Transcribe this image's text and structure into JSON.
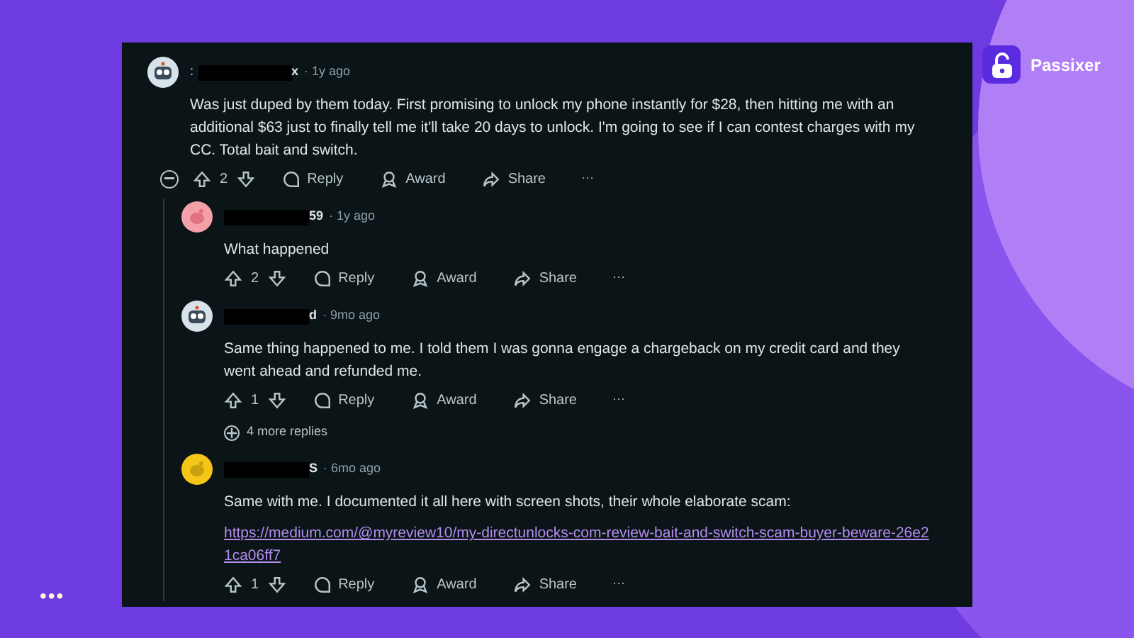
{
  "brand": {
    "name": "Passixer"
  },
  "more_button": {
    "label": "•••"
  },
  "comments": [
    {
      "author_suffix": ":",
      "author_end": "x",
      "time": "· 1y ago",
      "avatar": {
        "kind": "robot"
      },
      "collapse": true,
      "body": [
        "Was just duped by them today. First promising to unlock my phone instantly for $28, then hitting me with an additional $63 just to finally tell me it'll take 20 days to unlock. I'm going to see if I can contest charges with my CC. Total bait and switch."
      ],
      "votes": "2",
      "actions": [
        "Reply",
        "Award",
        "Share"
      ],
      "menu": "···",
      "children": [
        {
          "author_end": "59",
          "time": "· 1y ago",
          "avatar": {
            "kind": "pink"
          },
          "body": [
            "What happened"
          ],
          "votes": "2",
          "actions": [
            "Reply",
            "Award",
            "Share"
          ],
          "menu": "···"
        },
        {
          "author_end": "d",
          "time": "· 9mo ago",
          "avatar": {
            "kind": "robot"
          },
          "body": [
            "Same thing happened to me. I told them I was gonna engage a chargeback on my credit card and they went ahead and refunded me."
          ],
          "votes": "1",
          "actions": [
            "Reply",
            "Award",
            "Share"
          ],
          "menu": "···",
          "more_replies": "4 more replies"
        },
        {
          "author_end": "S",
          "time": "· 6mo ago",
          "avatar": {
            "kind": "yellow"
          },
          "body": [
            "Same with me. I documented it all here with screen shots, their whole elaborate scam:"
          ],
          "link": "https://medium.com/@myreview10/my-directunlocks-com-review-bait-and-switch-scam-buyer-beware-26e21ca06ff7",
          "votes": "1",
          "actions": [
            "Reply",
            "Award",
            "Share"
          ],
          "menu": "···"
        }
      ]
    }
  ]
}
